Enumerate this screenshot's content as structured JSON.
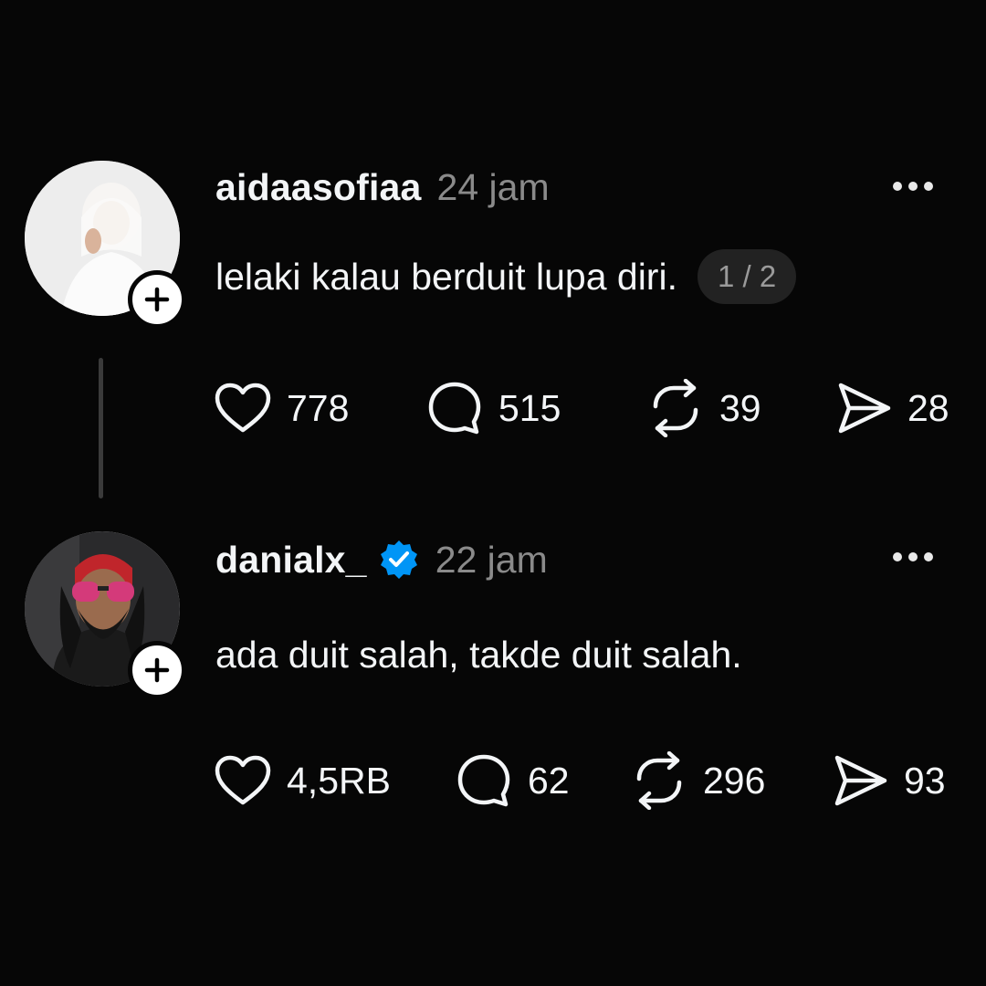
{
  "posts": [
    {
      "username": "aidaasofiaa",
      "verified": false,
      "time": "24 jam",
      "text": "lelaki kalau berduit lupa diri.",
      "page_indicator": "1 / 2",
      "likes": "778",
      "replies": "515",
      "reposts": "39",
      "shares": "28"
    },
    {
      "username": "danialx_",
      "verified": true,
      "time": "22 jam",
      "text": "ada duit salah, takde duit salah.",
      "likes": "4,5RB",
      "replies": "62",
      "reposts": "296",
      "shares": "93"
    }
  ],
  "icons": {
    "more": "more-horizontal-icon",
    "follow": "plus-icon",
    "like": "heart-icon",
    "reply": "comment-bubble-icon",
    "repost": "repost-icon",
    "share": "send-icon",
    "verified": "verified-badge-icon"
  },
  "colors": {
    "background": "#060606",
    "text": "#f3f5f7",
    "muted": "#8a8a8a",
    "verified": "#0095f6",
    "pill": "#222222"
  }
}
